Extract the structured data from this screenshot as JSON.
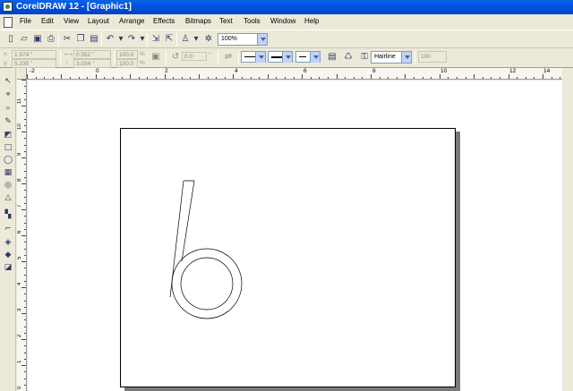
{
  "window": {
    "title": "CorelDRAW 12 - [Graphic1]"
  },
  "menu": [
    "File",
    "Edit",
    "View",
    "Layout",
    "Arrange",
    "Effects",
    "Bitmaps",
    "Text",
    "Tools",
    "Window",
    "Help"
  ],
  "toolbar": {
    "icons": [
      "new-icon",
      "open-icon",
      "save-icon",
      "print-icon",
      "cut-icon",
      "copy-icon",
      "paste-icon",
      "undo-icon",
      "redo-icon",
      "import-icon",
      "export-icon",
      "application-launcher-icon",
      "corel-online-icon"
    ],
    "zoom": "100%"
  },
  "property_bar": {
    "x_value": "1.974 \"",
    "y_value": "5.235 \"",
    "width_value": "0.552 \"",
    "height_value": "3.034 \"",
    "scale_x": "100.0",
    "scale_y": "100.0",
    "percent": "%",
    "rotation_value": "0.0",
    "degree": "°",
    "outline_width": "Hairline",
    "wrap_offset": "100"
  },
  "ruler": {
    "horizontal_labels": [
      "-2",
      "0",
      "2",
      "4",
      "6",
      "8",
      "10",
      "12",
      "14"
    ],
    "vertical_labels": [
      "11",
      "10",
      "9",
      "8",
      "7",
      "6",
      "5",
      "4",
      "3",
      "2",
      "1",
      "0"
    ]
  },
  "toolbox": [
    "pick-tool-icon",
    "shape-tool-icon",
    "zoom-tool-icon",
    "freehand-tool-icon",
    "smart-fill-tool-icon",
    "rectangle-tool-icon",
    "ellipse-tool-icon",
    "polygon-tool-icon",
    "spiral-tool-icon",
    "basic-shapes-tool-icon",
    "text-tool-icon",
    "interactive-blend-tool-icon",
    "eyedropper-tool-icon",
    "outline-tool-icon",
    "fill-tool-icon",
    "interactive-fill-tool-icon"
  ],
  "colors": {
    "titlebar": "#0054e3",
    "chrome": "#ece9d8",
    "page_shadow": "#7a7a7a"
  }
}
